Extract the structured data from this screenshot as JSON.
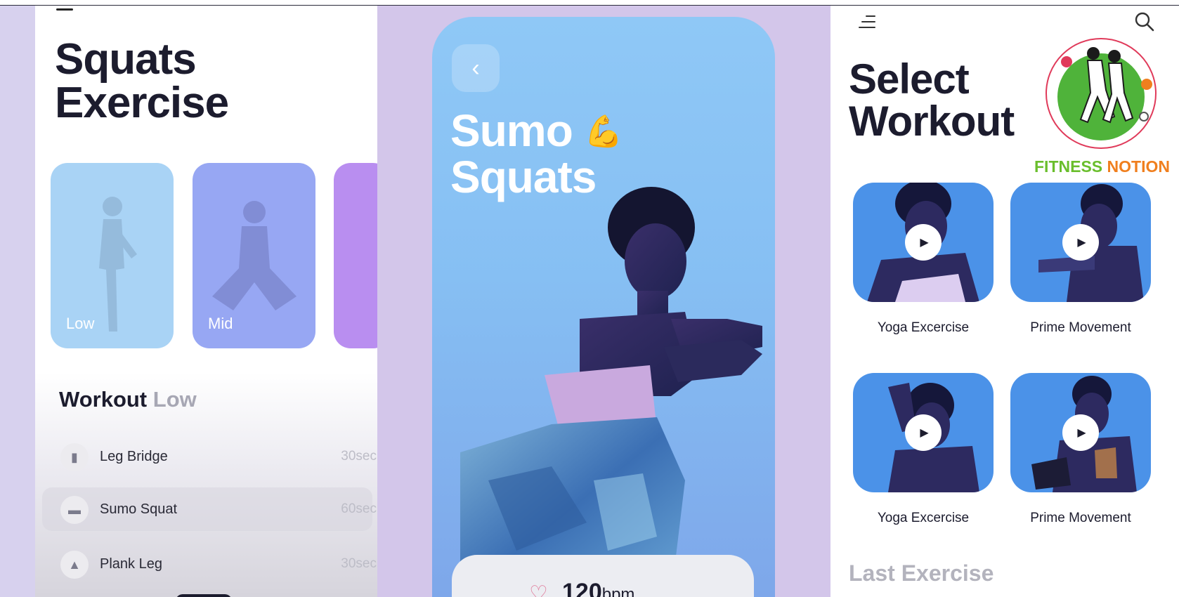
{
  "left_screen": {
    "title_line1": "Squats",
    "title_line2": "Exercise",
    "levels": [
      {
        "label": "Low"
      },
      {
        "label": "Mid"
      }
    ],
    "workout_heading": "Workout",
    "workout_level": "Low",
    "exercises": [
      {
        "name": "Leg Bridge",
        "duration": "30sec",
        "icon": "leg-bridge-icon"
      },
      {
        "name": "Sumo Squat",
        "duration": "60sec",
        "icon": "sumo-squat-icon"
      },
      {
        "name": "Plank Leg",
        "duration": "30sec",
        "icon": "plank-leg-icon"
      }
    ]
  },
  "middle_screen": {
    "title_line1": "Sumo",
    "title_line2": "Squats",
    "emoji": "💪",
    "heart_rate_value": "120",
    "heart_rate_unit": "bpm"
  },
  "right_screen": {
    "title_line1": "Select",
    "title_line2": "Workout",
    "brand_word1": "FITNESS",
    "brand_word2": "NOTION",
    "workouts": [
      {
        "label": "Yoga Excercise"
      },
      {
        "label": "Prime Movement"
      },
      {
        "label": "Yoga Excercise"
      },
      {
        "label": "Prime Movement"
      }
    ],
    "last_exercise_heading": "Last Exercise"
  },
  "colors": {
    "low_card": "#a9d3f5",
    "mid_card": "#97a7f3",
    "high_card": "#b98ef0",
    "hero_blue": "#8fc8f6",
    "brand_green": "#6abe2c",
    "brand_orange": "#f07f1e",
    "text_dark": "#1c1c2e"
  }
}
